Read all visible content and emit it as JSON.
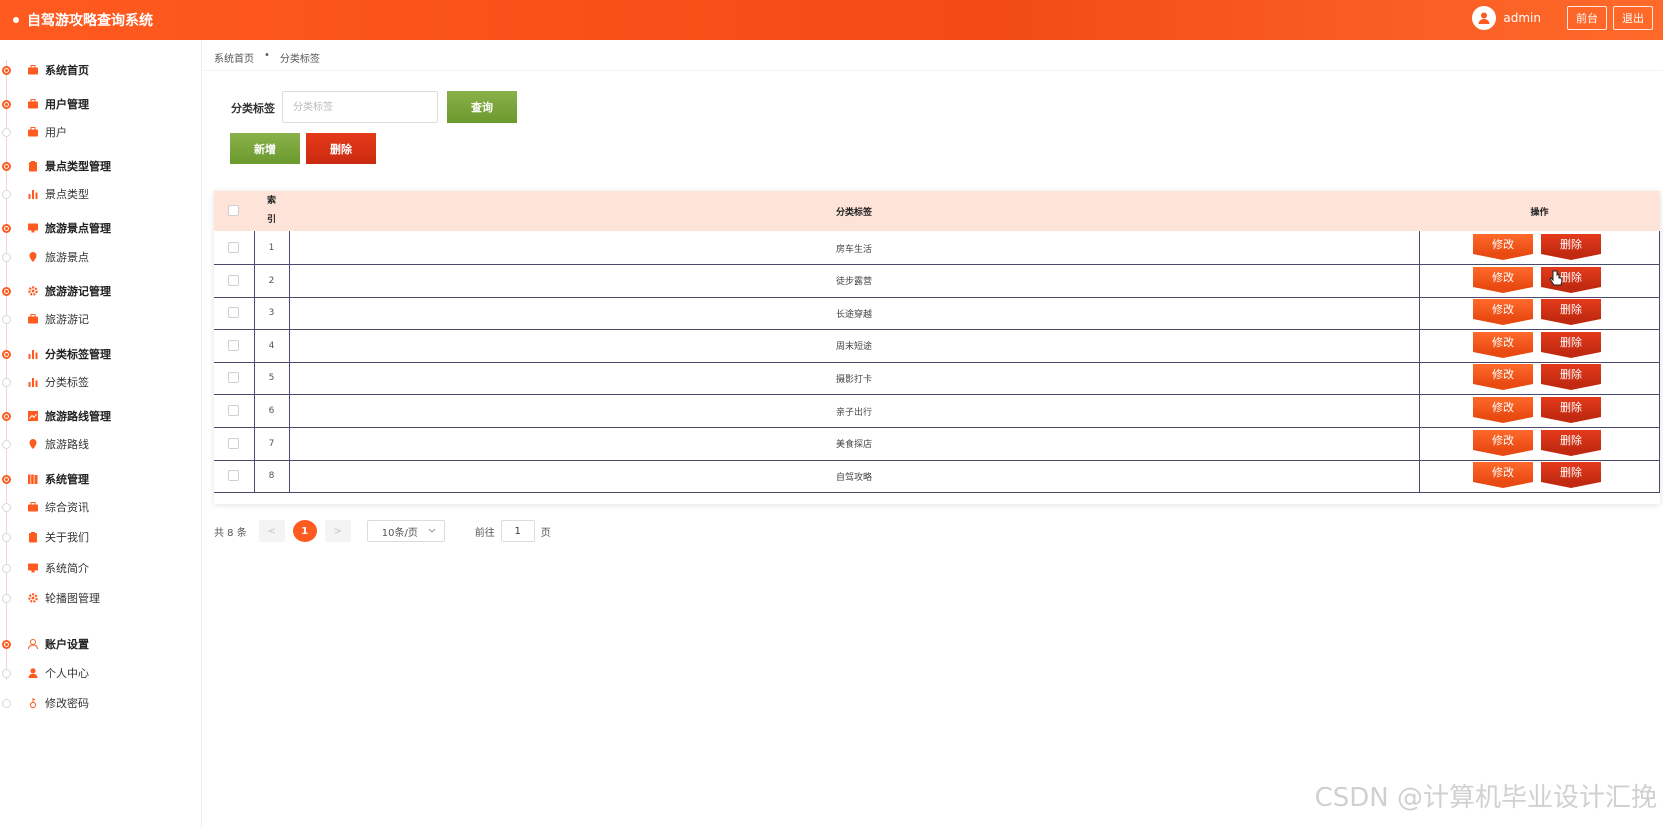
{
  "app": {
    "title": "自驾游攻略查询系统",
    "user": "admin",
    "btn_front": "前台",
    "btn_logout": "退出"
  },
  "colors": {
    "accent": "#ff5a1f",
    "green": "#7aa63a",
    "red": "#d6301a",
    "header_bg": "#fde3d8"
  },
  "sidebar": {
    "items": [
      {
        "label": "系统首页",
        "group": true,
        "icon": "briefcase-icon"
      },
      {
        "label": "用户管理",
        "group": true,
        "icon": "briefcase-icon"
      },
      {
        "label": "用户",
        "group": false,
        "icon": "briefcase-icon"
      },
      {
        "label": "景点类型管理",
        "group": true,
        "icon": "clipboard-icon"
      },
      {
        "label": "景点类型",
        "group": false,
        "icon": "bar-chart-icon"
      },
      {
        "label": "旅游景点管理",
        "group": true,
        "icon": "monitor-icon"
      },
      {
        "label": "旅游景点",
        "group": false,
        "icon": "location-pin-icon"
      },
      {
        "label": "旅游游记管理",
        "group": true,
        "icon": "gear-icon"
      },
      {
        "label": "旅游游记",
        "group": false,
        "icon": "briefcase-icon"
      },
      {
        "label": "分类标签管理",
        "group": true,
        "icon": "bar-chart-icon"
      },
      {
        "label": "分类标签",
        "group": false,
        "icon": "bar-chart-icon"
      },
      {
        "label": "旅游路线管理",
        "group": true,
        "icon": "line-chart-icon"
      },
      {
        "label": "旅游路线",
        "group": false,
        "icon": "location-pin-icon"
      },
      {
        "label": "系统管理",
        "group": true,
        "icon": "books-icon"
      },
      {
        "label": "综合资讯",
        "group": false,
        "icon": "briefcase-icon"
      },
      {
        "label": "关于我们",
        "group": false,
        "icon": "clipboard-icon"
      },
      {
        "label": "系统简介",
        "group": false,
        "icon": "monitor-icon"
      },
      {
        "label": "轮播图管理",
        "group": false,
        "icon": "gear-icon"
      },
      {
        "label": "账户设置",
        "group": true,
        "icon": "user-outline-icon"
      },
      {
        "label": "个人中心",
        "group": false,
        "icon": "user-icon"
      },
      {
        "label": "修改密码",
        "group": false,
        "icon": "key-icon"
      }
    ]
  },
  "breadcrumb": {
    "home": "系统首页",
    "sep": "•",
    "current": "分类标签"
  },
  "search": {
    "label": "分类标签",
    "placeholder": "分类标签",
    "value": "",
    "query_btn": "查询"
  },
  "actions": {
    "add": "新增",
    "delete": "删除"
  },
  "table": {
    "headers": {
      "index_1": "索",
      "index_2": "引",
      "tag": "分类标签",
      "op": "操作"
    },
    "edit_label": "修改",
    "delete_label": "删除",
    "rows": [
      {
        "index": "1",
        "tag": "房车生活"
      },
      {
        "index": "2",
        "tag": "徒步露营"
      },
      {
        "index": "3",
        "tag": "长途穿越"
      },
      {
        "index": "4",
        "tag": "周末短途"
      },
      {
        "index": "5",
        "tag": "摄影打卡"
      },
      {
        "index": "6",
        "tag": "亲子出行"
      },
      {
        "index": "7",
        "tag": "美食探店"
      },
      {
        "index": "8",
        "tag": "自驾攻略"
      }
    ]
  },
  "pagination": {
    "total": "共 8 条",
    "prev": "<",
    "current": "1",
    "next": ">",
    "page_size": "10条/页",
    "goto": "前往",
    "page_input": "1",
    "page_unit": "页"
  },
  "watermark": "CSDN @计算机毕业设计汇挽"
}
